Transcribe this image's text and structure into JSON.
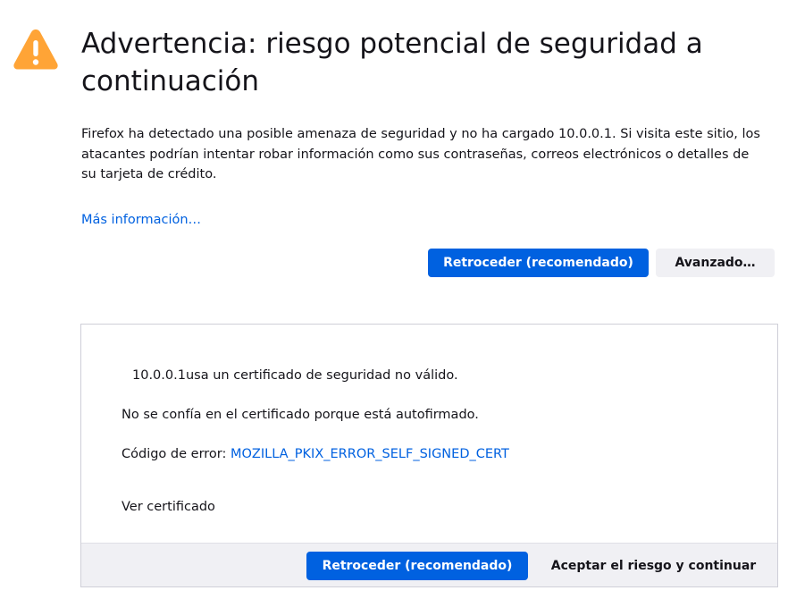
{
  "header": {
    "icon": "warning-triangle-icon",
    "icon_color": "#ffa436",
    "title": "Advertencia: riesgo potencial de seguridad a continuación"
  },
  "description": "Firefox ha detectado una posible amenaza de seguridad y no ha cargado 10.0.0.1. Si visita este sitio, los atacantes podrían intentar robar información como sus contraseñas, correos electrónicos o detalles de su tarjeta de crédito.",
  "more_info_link": "Más información…",
  "actions": {
    "back_label": "Retroceder (recomendado)",
    "advanced_label": "Avanzado…"
  },
  "advanced_panel": {
    "host": "10.0.0.1",
    "cert_invalid_text": "usa un certificado de seguridad no válido.",
    "untrusted_text": "No se confía en el certificado porque está autofirmado.",
    "error_code_label": "Código de error:",
    "error_code": "MOZILLA_PKIX_ERROR_SELF_SIGNED_CERT",
    "view_cert_link": "Ver certificado",
    "back_label": "Retroceder (recomendado)",
    "accept_label": "Aceptar el riesgo y continuar"
  },
  "colors": {
    "primary": "#0061e0",
    "link": "#0061e0",
    "secondary_button": "#f0f0f4",
    "warning": "#ffa436"
  }
}
